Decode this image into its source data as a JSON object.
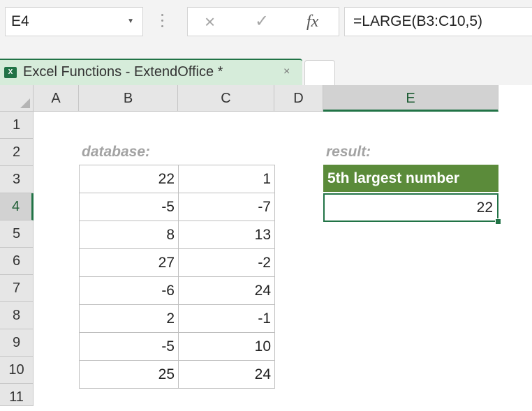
{
  "formula_bar": {
    "name_box": "E4",
    "cancel_icon": "×",
    "enter_icon": "✓",
    "fx_label": "fx",
    "formula": "=LARGE(B3:C10,5)"
  },
  "tab": {
    "title": "Excel Functions - ExtendOffice *",
    "icon_label": "X",
    "close": "×"
  },
  "columns": [
    "A",
    "B",
    "C",
    "D",
    "E"
  ],
  "rows": [
    "1",
    "2",
    "3",
    "4",
    "5",
    "6",
    "7",
    "8",
    "9",
    "10",
    "11"
  ],
  "active": {
    "column": "E",
    "row": "4"
  },
  "labels": {
    "database": "database:",
    "result": "result:"
  },
  "database": [
    [
      "22",
      "1"
    ],
    [
      "-5",
      "-7"
    ],
    [
      "8",
      "13"
    ],
    [
      "27",
      "-2"
    ],
    [
      "-6",
      "24"
    ],
    [
      "2",
      "-1"
    ],
    [
      "-5",
      "10"
    ],
    [
      "25",
      "24"
    ]
  ],
  "result": {
    "header": "5th largest number",
    "value": "22"
  },
  "colors": {
    "excel_green": "#217346",
    "result_header_bg": "#5b8b3a",
    "tab_bg": "#d6ecda"
  }
}
